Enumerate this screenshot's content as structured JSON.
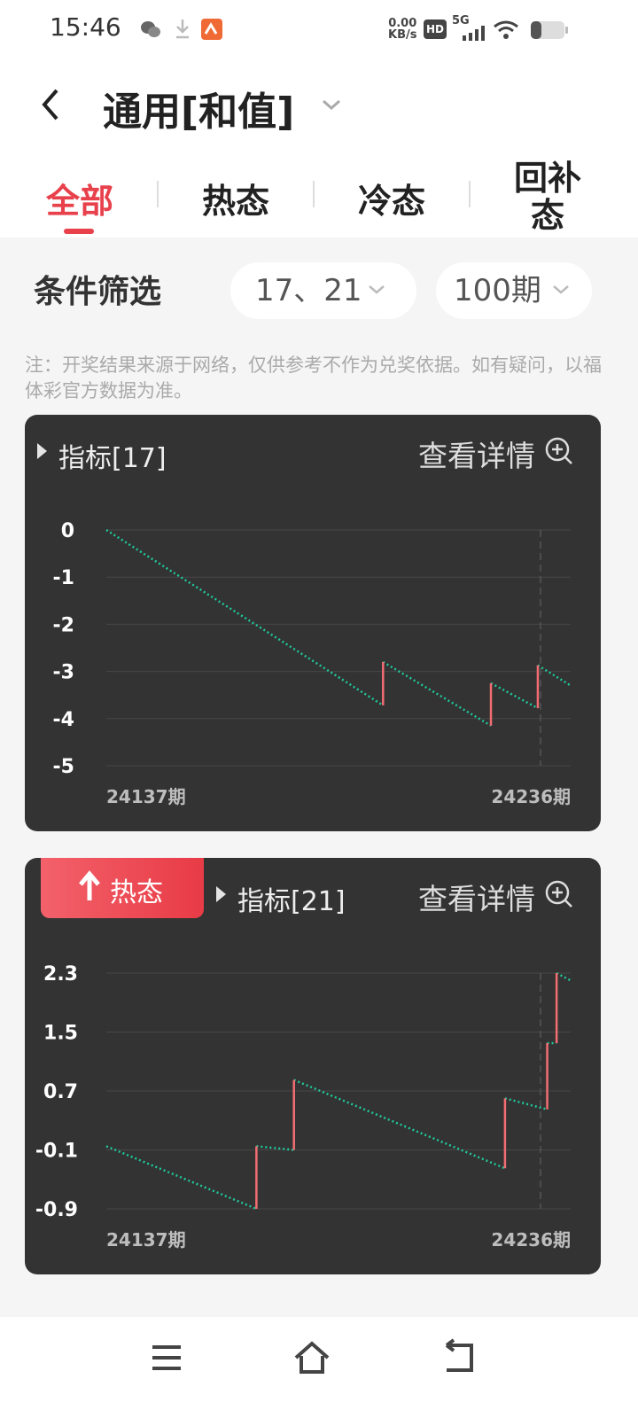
{
  "status_bar": {
    "time": "15:46",
    "net_speed_value": "0.00",
    "net_speed_unit": "KB/s",
    "hd_label": "HD",
    "network_label": "5G",
    "icons": [
      "wechat-icon",
      "download-icon",
      "app-notification-icon",
      "hd-icon",
      "signal-icon",
      "wifi-icon",
      "battery-icon"
    ]
  },
  "header": {
    "title": "通用[和值]"
  },
  "tabs": [
    {
      "label": "全部",
      "active": true
    },
    {
      "label": "热态",
      "active": false
    },
    {
      "label": "冷态",
      "active": false
    },
    {
      "label": "回补态",
      "active": false
    }
  ],
  "filter": {
    "label": "条件筛选",
    "numbers_value": "17、21",
    "period_value": "100期"
  },
  "note": "注：开奖结果来源于网络，仅供参考不作为兑奖依据。如有疑问，以福体彩官方数据为准。",
  "colors": {
    "accent": "#e8414b",
    "card_bg": "#333333",
    "line_green": "#1fc99a",
    "jump_red": "#f26d72"
  },
  "cards": [
    {
      "title": "指标[17]",
      "detail_label": "查看详情",
      "badge": null
    },
    {
      "title": "指标[21]",
      "detail_label": "查看详情",
      "badge": "热态"
    }
  ],
  "chart_data": [
    {
      "type": "line",
      "ylim": [
        -5,
        0
      ],
      "yticks": [
        "0",
        "-1",
        "-2",
        "-3",
        "-4",
        "-5"
      ],
      "x_start_label": "24137期",
      "x_end_label": "24236期",
      "x": [
        0,
        59,
        59,
        82,
        82,
        92,
        92,
        99
      ],
      "y": [
        0,
        -3.72,
        -2.8,
        -4.15,
        -3.25,
        -3.78,
        -2.87,
        -3.3
      ],
      "jumps": [
        [
          59,
          -3.72,
          -2.8
        ],
        [
          82,
          -4.15,
          -3.25
        ],
        [
          92,
          -3.78,
          -2.87
        ]
      ]
    },
    {
      "type": "line",
      "ylim": [
        -0.9,
        2.3
      ],
      "yticks": [
        "2.3",
        "1.5",
        "0.7",
        "-0.1",
        "-0.9"
      ],
      "x_start_label": "24137期",
      "x_end_label": "24236期",
      "x": [
        0,
        32,
        32,
        40,
        40,
        85,
        85,
        94,
        94,
        96,
        96,
        99
      ],
      "y": [
        -0.05,
        -0.9,
        -0.05,
        -0.1,
        0.85,
        -0.35,
        0.6,
        0.45,
        1.35,
        1.35,
        2.3,
        2.2
      ],
      "jumps": [
        [
          32,
          -0.9,
          -0.05
        ],
        [
          40,
          -0.1,
          0.85
        ],
        [
          85,
          -0.35,
          0.6
        ],
        [
          94,
          0.45,
          1.35
        ],
        [
          96,
          1.35,
          2.3
        ]
      ]
    }
  ]
}
